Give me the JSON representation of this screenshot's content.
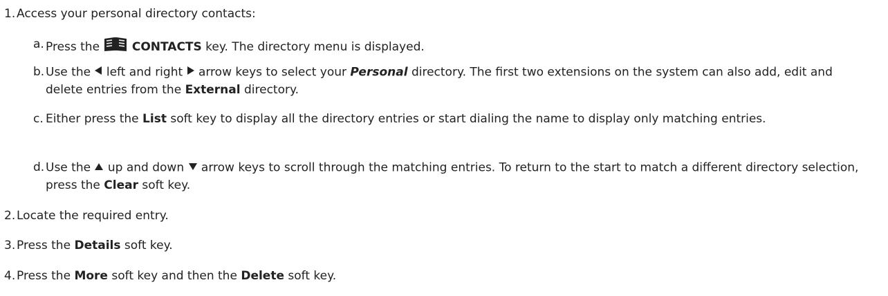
{
  "steps": [
    {
      "num": "1.",
      "text": "Access your personal directory contacts:"
    },
    {
      "num": "2.",
      "text": "Locate the required entry."
    },
    {
      "num": "3.",
      "pre": "Press the ",
      "bold": "Details",
      "post": " soft key."
    },
    {
      "num": "4.",
      "pre": "Press the ",
      "bold1": "More",
      "mid": " soft key and then the ",
      "bold2": "Delete",
      "post": " soft key."
    }
  ],
  "substeps": {
    "a": {
      "num": "a.",
      "pre": "Press the ",
      "bold": "CONTACTS",
      "post": " key. The directory menu is displayed.",
      "icon": "book-icon"
    },
    "b": {
      "num": "b.",
      "pre": "Use the ",
      "left_icon": "left-arrow-icon",
      "mid1": " left and right ",
      "right_icon": "right-arrow-icon",
      "mid2": " arrow keys to select your ",
      "bolditalic": "Personal",
      "mid3": " directory. The first two extensions on the system can also add, edit and delete entries from the ",
      "bold": "External",
      "post": " directory."
    },
    "c": {
      "num": "c.",
      "pre": "Either press the ",
      "bold": "List",
      "post": " soft key to display all the directory entries or start dialing the name to display only matching entries."
    },
    "d": {
      "num": "d.",
      "pre": "Use the ",
      "up_icon": "up-arrow-icon",
      "mid1": " up and down ",
      "down_icon": "down-arrow-icon",
      "mid2": " arrow keys to scroll through the matching entries. To return to the start to match a different directory selection, press the ",
      "bold": "Clear",
      "post": " soft key."
    }
  }
}
